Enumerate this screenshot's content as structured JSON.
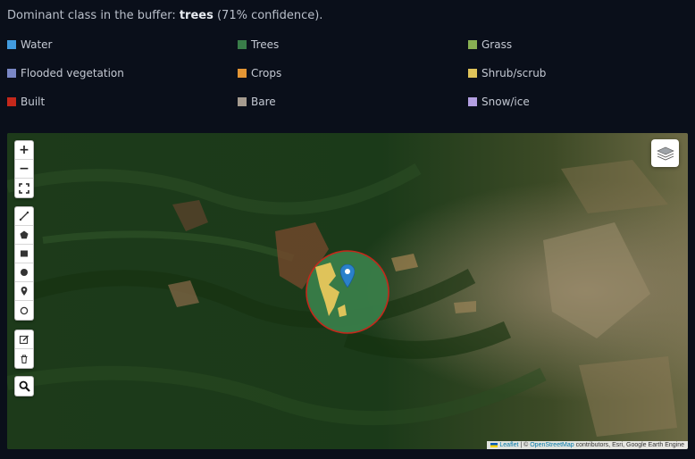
{
  "summary": {
    "prefix": "Dominant class in the buffer: ",
    "dominant_class": "trees",
    "suffix": " (71% confidence)."
  },
  "legend": [
    {
      "label": "Water",
      "color": "#419bdf"
    },
    {
      "label": "Trees",
      "color": "#397d49"
    },
    {
      "label": "Grass",
      "color": "#88b053"
    },
    {
      "label": "Flooded vegetation",
      "color": "#7a87c6"
    },
    {
      "label": "Crops",
      "color": "#e49635"
    },
    {
      "label": "Shrub/scrub",
      "color": "#dfc35a"
    },
    {
      "label": "Built",
      "color": "#c4281b"
    },
    {
      "label": "Bare",
      "color": "#a59b8f"
    },
    {
      "label": "Snow/ice",
      "color": "#b39fe1"
    }
  ],
  "map": {
    "controls": {
      "zoom_in": "+",
      "zoom_out": "−",
      "tools": [
        "fullscreen-icon",
        "draw-polyline-icon",
        "draw-polygon-icon",
        "draw-rectangle-icon",
        "draw-circle-icon",
        "draw-marker-icon",
        "draw-circlemarker-icon",
        "edit-layers-icon",
        "delete-layers-icon",
        "search-icon"
      ]
    },
    "buffer_color": "#397d49",
    "buffer_outline": "#c4281b",
    "marker_color": "#2a81cb",
    "attribution": {
      "leaflet": "Leaflet",
      "sep": " | © ",
      "osm": "OpenStreetMap",
      "rest": " contributors, Esri, Google Earth Engine"
    }
  }
}
